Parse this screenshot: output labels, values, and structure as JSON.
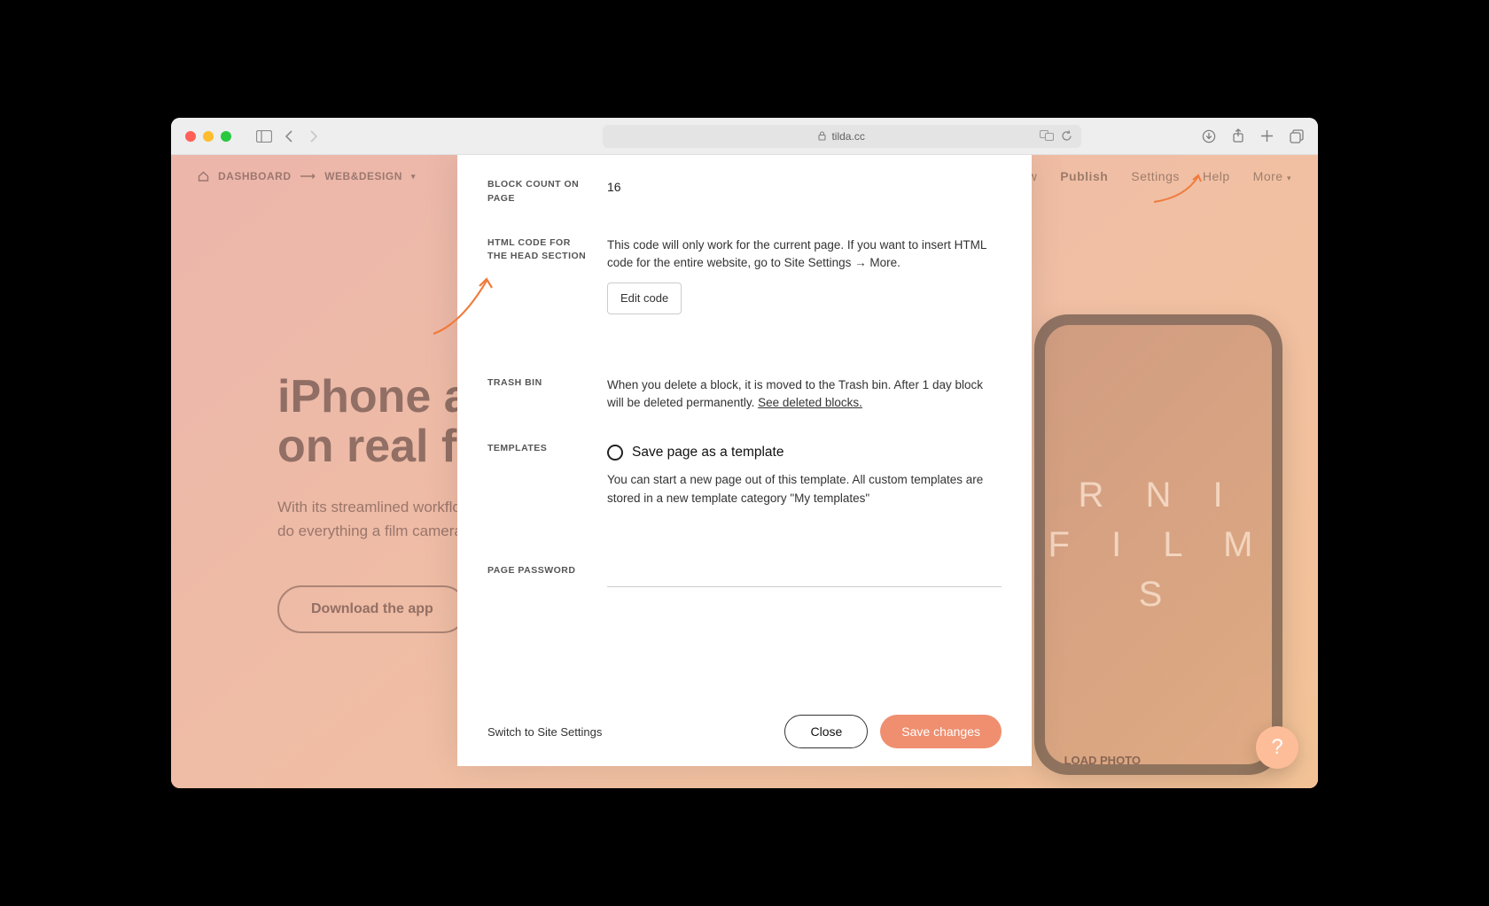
{
  "browser": {
    "url_host": "tilda.cc"
  },
  "topnav": {
    "home": "DASHBOARD",
    "arrow": "⟶",
    "project": "WEB&DESIGN",
    "right": {
      "preview": "view",
      "publish": "Publish",
      "settings": "Settings",
      "help": "Help",
      "more": "More"
    }
  },
  "hero": {
    "title_l1": "iPhone ap",
    "title_l2": "on real fil",
    "desc": "With its streamlined workflow from real film, RNI Films is designed to do everything a film camera can do, just in a few taps.",
    "cta": "Download the app"
  },
  "phone": {
    "brand_l1": "R N I",
    "brand_l2": "F I L M S"
  },
  "uploadphoto": "LOAD PHOTO",
  "helpfab": "?",
  "modal": {
    "block_count": {
      "label": "BLOCK COUNT ON PAGE",
      "value": "16"
    },
    "htmlhead": {
      "label": "HTML CODE FOR THE HEAD SECTION",
      "desc": "This code will only work for the current page. If you want to insert HTML code for the entire website, go to Site Settings → More.",
      "button": "Edit code"
    },
    "trash": {
      "label": "TRASH BIN",
      "desc": "When you delete a block, it is moved to the Trash bin. After 1 day block will be deleted permanently. ",
      "link": "See deleted blocks."
    },
    "templates": {
      "label": "TEMPLATES",
      "radio": "Save page as a template",
      "desc": "You can start a new page out of this template. All custom templates are stored in a new template category \"My templates\""
    },
    "password": {
      "label": "PAGE PASSWORD",
      "value": ""
    },
    "footer": {
      "switch": "Switch to Site Settings",
      "close": "Close",
      "save": "Save changes"
    }
  }
}
